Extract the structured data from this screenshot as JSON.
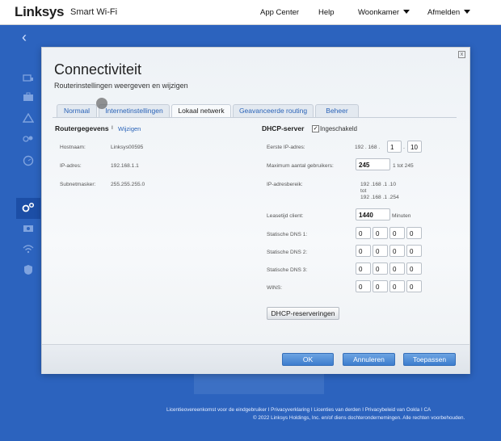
{
  "header": {
    "logo": "Linksys",
    "product": "Smart Wi-Fi",
    "nav": {
      "app_center": "App Center",
      "help": "Help",
      "location": "Woonkamer",
      "logout": "Afmelden"
    }
  },
  "sidebar": {
    "back": "‹",
    "icons": [
      "device-list-icon",
      "toolbox-icon",
      "warning-icon",
      "parental-controls-icon",
      "speed-icon",
      "connectivity-gear-icon",
      "camera-icon",
      "wifi-icon",
      "security-shield-icon"
    ]
  },
  "dialog": {
    "title": "Connectiviteit",
    "subtitle": "Routerinstellingen weergeven en wijzigen",
    "close": "x",
    "tabs": [
      "Normaal",
      "Internetinstellingen",
      "Lokaal netwerk",
      "Geavanceerde routing",
      "Beheer"
    ],
    "active_tab": "Lokaal netwerk",
    "router": {
      "heading": "Routergegevens",
      "separator": "I",
      "edit_link": "Wijzigen",
      "rows": [
        {
          "label": "Hostnaam:",
          "value": "Linksys00595"
        },
        {
          "label": "IP-adres:",
          "value": "192.168.1.1"
        },
        {
          "label": "Subnetmasker:",
          "value": "255.255.255.0"
        }
      ]
    },
    "dhcp": {
      "heading": "DHCP-server",
      "enabled_label": "Ingeschakeld",
      "enabled": true,
      "start_ip": {
        "label": "Eerste IP-adres:",
        "fixed": "192 . 168 .",
        "oct3": "1",
        "oct4": "10"
      },
      "max_users": {
        "label": "Maximum aantal gebruikers:",
        "value": "245",
        "suffix": "1 tot 245"
      },
      "range": {
        "label": "IP-adresbereik:",
        "line1": "192 .168 .1 .10",
        "line2": "tot",
        "line3": "192 .168 .1 .254"
      },
      "lease": {
        "label": "Leasetijd client:",
        "value": "1440",
        "suffix": "Minuten"
      },
      "dns1": {
        "label": "Statische DNS 1:",
        "values": [
          "0",
          "0",
          "0",
          "0"
        ]
      },
      "dns2": {
        "label": "Statische DNS 2:",
        "values": [
          "0",
          "0",
          "0",
          "0"
        ]
      },
      "dns3": {
        "label": "Statische DNS 3:",
        "values": [
          "0",
          "0",
          "0",
          "0"
        ]
      },
      "wins": {
        "label": "WINS:",
        "values": [
          "0",
          "0",
          "0",
          "0"
        ]
      },
      "reservations_button": "DHCP-reserveringen"
    },
    "buttons": {
      "ok": "OK",
      "cancel": "Annuleren",
      "apply": "Toepassen"
    }
  },
  "footer": {
    "links": "Licentieovereenkomst voor de eindgebruiker  I  Privacyverklaring  I  Licenties van derden  I  Privacybeleid van Ookla  I  CA",
    "copyright": "© 2022 Linksys Holdings, Inc. en/of diens dochterondernemingen. Alle rechten voorbehouden."
  },
  "colors": {
    "page_bg": "#2c63be",
    "accent": "#2a63b8",
    "button_blue": "#4a8ad8"
  }
}
